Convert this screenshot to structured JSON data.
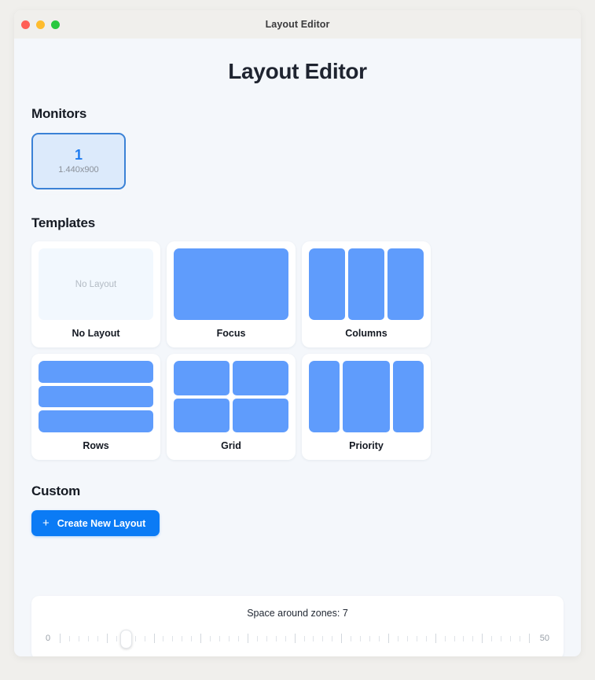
{
  "window": {
    "titlebar_title": "Layout Editor",
    "controls": [
      {
        "name": "close",
        "color": "#ff5f57"
      },
      {
        "name": "minimize",
        "color": "#febc2e"
      },
      {
        "name": "maximize",
        "color": "#28c840"
      }
    ]
  },
  "page": {
    "title": "Layout Editor"
  },
  "monitors": {
    "heading": "Monitors",
    "items": [
      {
        "index": "1",
        "resolution": "1.440x900",
        "selected": true
      }
    ]
  },
  "templates": {
    "heading": "Templates",
    "items": [
      {
        "label": "No Layout",
        "preview_type": "empty",
        "preview_label": "No Layout",
        "zones": 0
      },
      {
        "label": "Focus",
        "preview_type": "focus",
        "zones": 1
      },
      {
        "label": "Columns",
        "preview_type": "columns",
        "zones": 3
      },
      {
        "label": "Rows",
        "preview_type": "rows",
        "zones": 3
      },
      {
        "label": "Grid",
        "preview_type": "grid2",
        "zones": 4
      },
      {
        "label": "Priority",
        "preview_type": "priority",
        "zones": 3
      }
    ]
  },
  "custom": {
    "heading": "Custom",
    "create_button_label": "Create New Layout",
    "create_button_icon": "plus-icon"
  },
  "spacing": {
    "caption": "Space around zones: 7",
    "value": 7,
    "min_label": "0",
    "max_label": "50",
    "min": 0,
    "max": 50,
    "tick_count": 51
  },
  "colors": {
    "zone_blue": "#5f9cfc",
    "accent_blue": "#0b7bf5",
    "monitor_border": "#3b82d6",
    "monitor_fill": "#dceafb",
    "page_bg": "#f4f7fb",
    "desktop_bg": "#f0efec",
    "card_bg": "#ffffff"
  }
}
